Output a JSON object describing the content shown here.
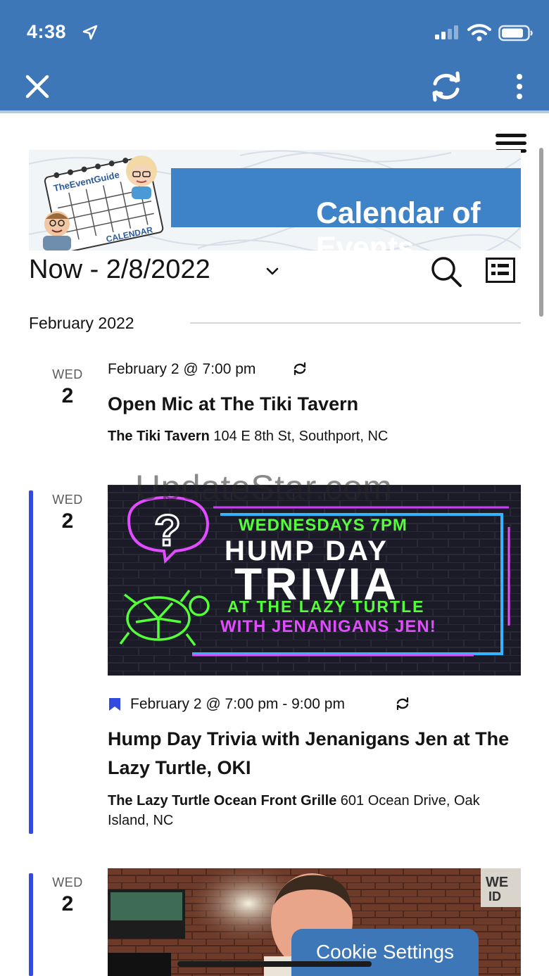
{
  "status_bar": {
    "time": "4:38"
  },
  "app_bar": {
    "close_icon": "close-icon",
    "refresh_icon": "refresh-icon",
    "more_icon": "more-vertical-icon",
    "color": "#3d77b8"
  },
  "banner": {
    "title": "Calendar of Events",
    "logo_line1": "TheEventGuide",
    "logo_line2": "CALENDAR"
  },
  "toolbar": {
    "date_range": "Now - 2/8/2022",
    "search_icon": "search-icon",
    "view_icon": "list-view-icon"
  },
  "month": {
    "label": "February 2022"
  },
  "events": [
    {
      "day_name": "WED",
      "day_num": "2",
      "time": "February 2 @ 7:00 pm",
      "title": "Open Mic at The Tiki Tavern",
      "venue_name": "The Tiki Tavern",
      "venue_address": " 104 E 8th St, Southport, NC"
    },
    {
      "day_name": "WED",
      "day_num": "2",
      "time": "February 2 @ 7:00 pm - 9:00 pm",
      "title": "Hump Day Trivia with Jenanigans Jen at The Lazy Turtle, OKI",
      "venue_name": "The Lazy Turtle Ocean Front Grille",
      "venue_address": " 601 Ocean Drive, Oak Island, NC",
      "image_text": {
        "line1": "WEDNESDAYS 7PM",
        "line2": "HUMP DAY",
        "line3": "TRIVIA",
        "line4": "AT THE LAZY TURTLE",
        "line5": "WITH JENANIGANS JEN!"
      }
    },
    {
      "day_name": "WED",
      "day_num": "2"
    }
  ],
  "watermark": "UpdateStar.com",
  "cookie_button": "Cookie Settings",
  "accent_color": "#334ae0"
}
